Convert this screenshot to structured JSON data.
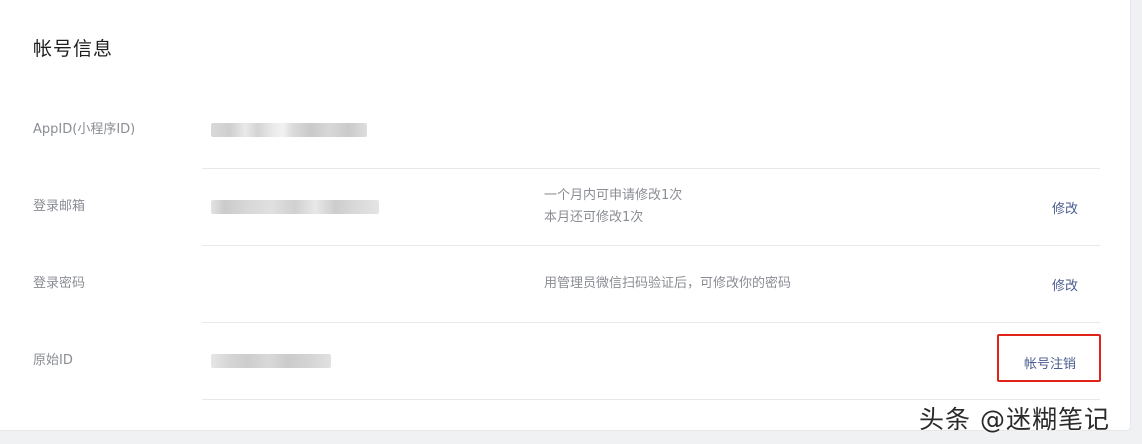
{
  "section_title": "帐号信息",
  "rows": [
    {
      "label": "AppID(小程序ID)"
    },
    {
      "label": "登录邮箱",
      "tip_line1": "一个月内可申请修改1次",
      "tip_line2": "本月还可修改1次",
      "action": "修改"
    },
    {
      "label": "登录密码",
      "tip": "用管理员微信扫码验证后，可修改你的密码",
      "action": "修改"
    },
    {
      "label": "原始ID",
      "action": "帐号注销"
    }
  ],
  "watermark": "头条 @迷糊笔记",
  "colors": {
    "link": "#4a5d8e",
    "highlight_box": "#e2231a",
    "label": "#8a8d93"
  }
}
